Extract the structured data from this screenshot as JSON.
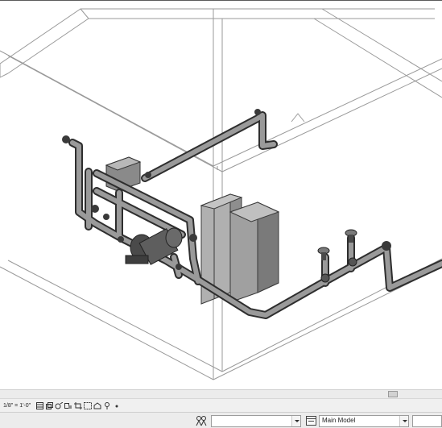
{
  "view": {
    "scale": "1/8\" = 1'-0\"",
    "controls": [
      {
        "name": "detail-level-icon",
        "glyph": "▦"
      },
      {
        "name": "visual-style-icon",
        "glyph": "▣"
      },
      {
        "name": "sun-path-icon",
        "glyph": "☀"
      },
      {
        "name": "shadows-icon",
        "glyph": "◑"
      },
      {
        "name": "crop-view-icon",
        "glyph": "⌗"
      },
      {
        "name": "show-crop-icon",
        "glyph": "⌧"
      },
      {
        "name": "unlock-view-icon",
        "glyph": "⌂"
      },
      {
        "name": "temporary-hide-icon",
        "glyph": "⚲"
      },
      {
        "name": "reveal-hidden-icon",
        "glyph": "◦"
      }
    ]
  },
  "status": {
    "workset_value": "",
    "design_option": "Main Model",
    "editable_value": ""
  },
  "colors": {
    "model_line": "#6e6e6e",
    "pipe_fill": "#8a8a8a",
    "equipment_fill": "#a6a6a6"
  }
}
